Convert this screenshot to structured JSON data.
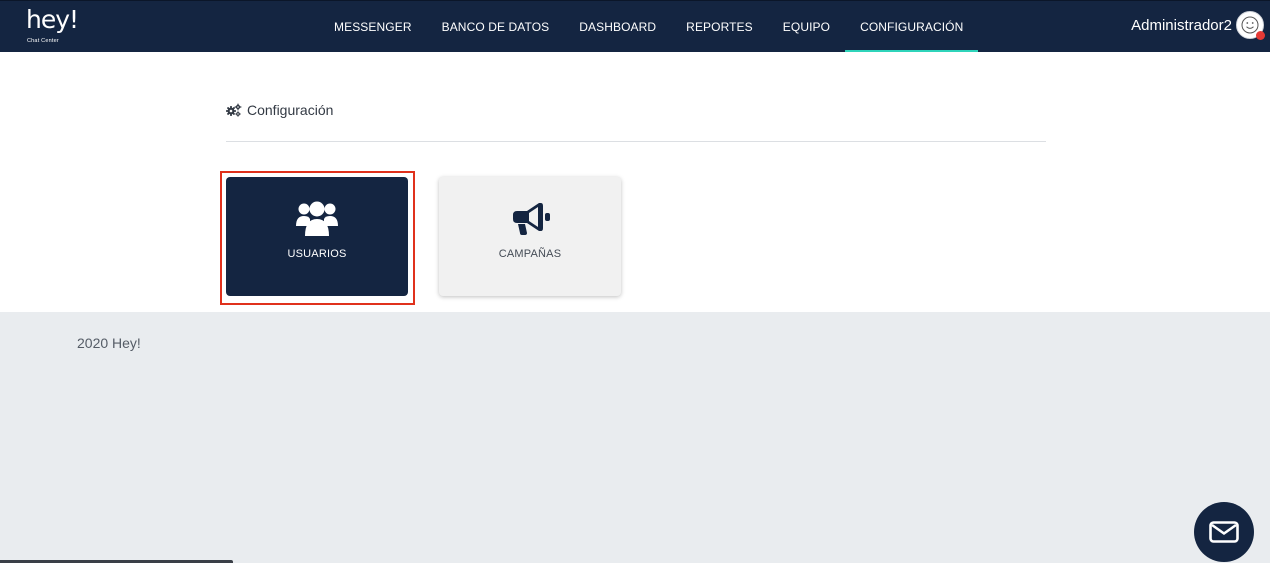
{
  "brand": {
    "logo_text": "hey!",
    "logo_subtitle": "Chat Center"
  },
  "nav": {
    "items": [
      {
        "label": "MESSENGER"
      },
      {
        "label": "BANCO DE DATOS"
      },
      {
        "label": "DASHBOARD"
      },
      {
        "label": "REPORTES"
      },
      {
        "label": "EQUIPO"
      },
      {
        "label": "CONFIGURACIÓN",
        "active": true
      }
    ]
  },
  "user": {
    "name": "Administrador2",
    "status_color": "#e53935",
    "avatar_icon": "smiley-face-icon"
  },
  "page": {
    "title": "Configuración",
    "title_icon": "gears-icon",
    "cards": [
      {
        "label": "USUARIOS",
        "icon": "users-icon",
        "selected": true
      },
      {
        "label": "CAMPAÑAS",
        "icon": "megaphone-icon",
        "selected": false
      }
    ]
  },
  "footer": {
    "text": "2020 Hey!"
  },
  "chat_button": {
    "icon": "envelope-icon"
  },
  "colors": {
    "primary": "#142541",
    "accent": "#2fd4ba",
    "highlight": "#e0311c",
    "card_light": "#f1f1f1"
  }
}
